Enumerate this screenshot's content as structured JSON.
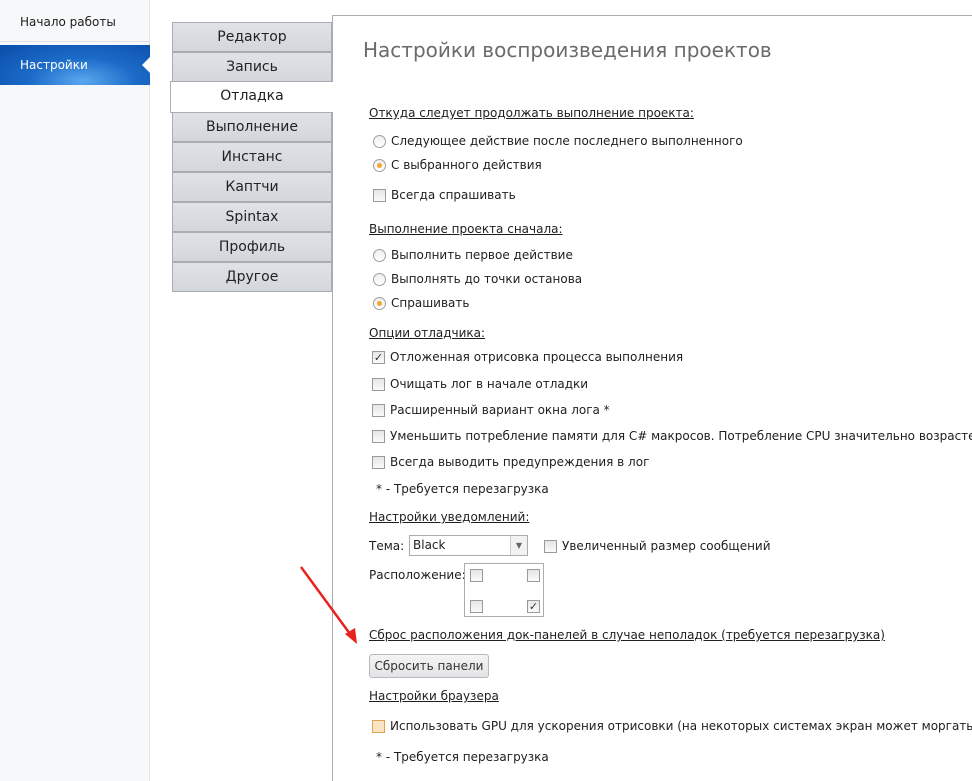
{
  "sidebar": {
    "items": [
      {
        "label": "Начало работы"
      },
      {
        "label": "Настройки"
      }
    ]
  },
  "tabs": [
    "Редактор",
    "Запись",
    "Отладка",
    "Выполнение",
    "Инстанс",
    "Каптчи",
    "Spintax",
    "Профиль",
    "Другое"
  ],
  "title": "Настройки воспроизведения проектов",
  "continue": {
    "header": "Откуда следует продолжать выполнение проекта:",
    "opt1": "Следующее действие после последнего выполненного",
    "opt2": "С выбранного действия",
    "always_ask": "Всегда спрашивать"
  },
  "from_start": {
    "header": "Выполнение проекта сначала:",
    "opt1": "Выполнить первое действие",
    "opt2": "Выполнять до точки останова",
    "opt3": "Спрашивать"
  },
  "debugger": {
    "header": "Опции отладчика:",
    "items": [
      "Отложенная отрисовка процесса выполнения",
      "Очищать лог в начале отладки",
      "Расширенный вариант окна лога *",
      "Уменьшить потребление памяти для C# макросов. Потребление CPU значительно возрастет. *",
      "Всегда выводить предупреждения в лог"
    ],
    "checked": [
      true,
      false,
      false,
      false,
      false
    ],
    "note": "* - Требуется перезагрузка"
  },
  "notify": {
    "header": "Настройки уведомлений:",
    "theme_label": "Тема:",
    "theme_value": "Black",
    "bigger": "Увеличенный размер сообщений",
    "position_label": "Расположение:",
    "position_selected": "bottom-right"
  },
  "dock": {
    "header": "Сброс расположения док-панелей в случае неполадок (требуется перезагрузка)",
    "button": "Сбросить панели"
  },
  "browser": {
    "header": "Настройки браузера",
    "gpu": "Использовать GPU для ускорения отрисовки (на некоторых системах экран может моргать). *",
    "note": "* - Требуется перезагрузка"
  },
  "colors": {
    "accent": "#1c6bc8",
    "arrow": "#e8231f"
  }
}
